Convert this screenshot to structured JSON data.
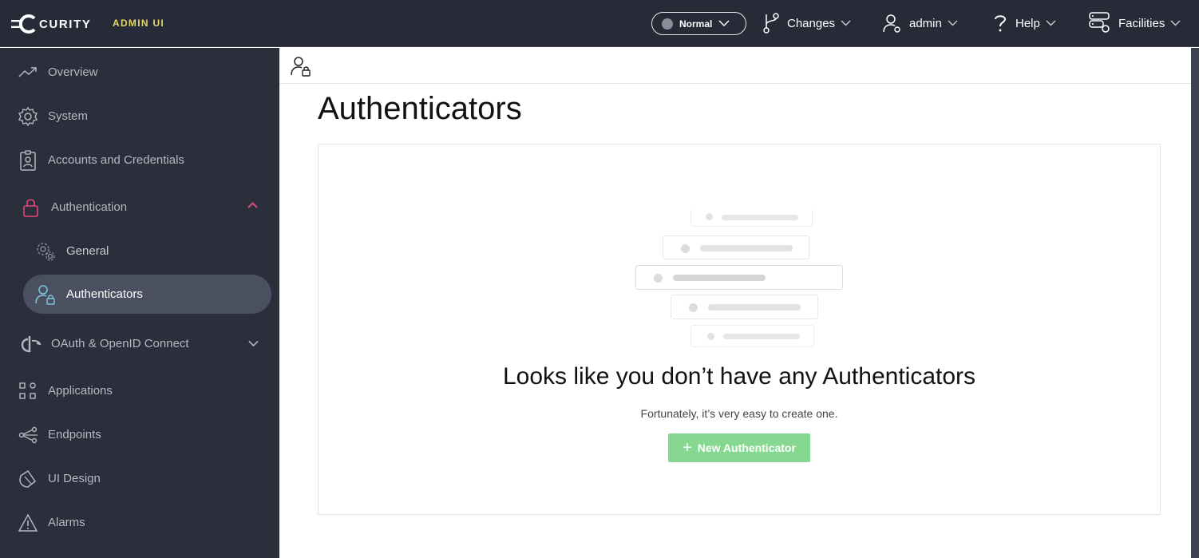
{
  "header": {
    "brand": "CURITY",
    "subtitle": "ADMIN UI",
    "mode": {
      "label": "Normal"
    },
    "nav": [
      {
        "label": "Changes",
        "icon": "branch-icon"
      },
      {
        "label": "admin",
        "icon": "user-gear-icon"
      },
      {
        "label": "Help",
        "icon": "question-icon"
      },
      {
        "label": "Facilities",
        "icon": "server-gear-icon"
      }
    ]
  },
  "sidebar": {
    "items": [
      {
        "label": "Overview",
        "icon": "trend-icon"
      },
      {
        "label": "System",
        "icon": "gear-icon"
      },
      {
        "label": "Accounts and Credentials",
        "icon": "badge-icon"
      },
      {
        "label": "Authentication",
        "icon": "lock-icon",
        "expanded": true
      },
      {
        "label": "General",
        "icon": "gears-icon"
      },
      {
        "label": "Authenticators",
        "icon": "user-lock-icon",
        "active": true
      },
      {
        "label": "OAuth & OpenID Connect",
        "icon": "oauth-icon"
      },
      {
        "label": "Applications",
        "icon": "apps-icon"
      },
      {
        "label": "Endpoints",
        "icon": "endpoints-icon"
      },
      {
        "label": "UI Design",
        "icon": "palette-icon"
      },
      {
        "label": "Alarms",
        "icon": "warning-icon"
      }
    ]
  },
  "main": {
    "title": "Authenticators",
    "empty_title": "Looks like you don’t have any Authenticators",
    "empty_subtitle": "Fortunately, it’s very easy to create one.",
    "new_button": "New Authenticator"
  },
  "colors": {
    "topbar": "#272b37",
    "sidebar": "#2b2f3b",
    "accent_pink": "#e2457a",
    "active_item": "#4a5060",
    "button_green": "#86d890",
    "brand_yellow": "#e8d66a"
  }
}
